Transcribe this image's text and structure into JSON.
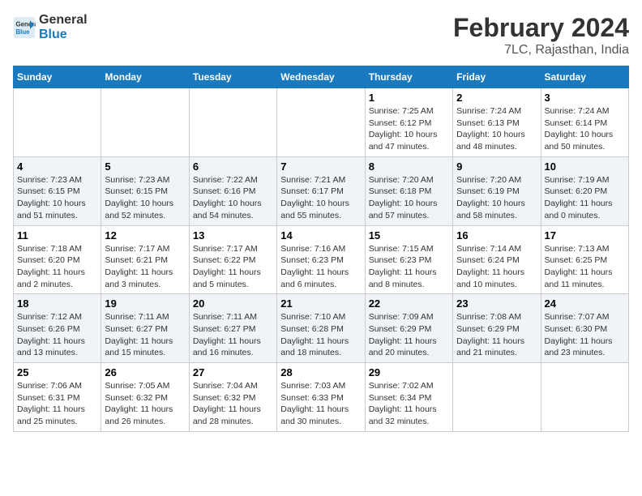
{
  "header": {
    "logo_line1": "General",
    "logo_line2": "Blue",
    "title": "February 2024",
    "subtitle": "7LC, Rajasthan, India"
  },
  "weekdays": [
    "Sunday",
    "Monday",
    "Tuesday",
    "Wednesday",
    "Thursday",
    "Friday",
    "Saturday"
  ],
  "weeks": [
    [
      {
        "day": "",
        "info": ""
      },
      {
        "day": "",
        "info": ""
      },
      {
        "day": "",
        "info": ""
      },
      {
        "day": "",
        "info": ""
      },
      {
        "day": "1",
        "info": "Sunrise: 7:25 AM\nSunset: 6:12 PM\nDaylight: 10 hours\nand 47 minutes."
      },
      {
        "day": "2",
        "info": "Sunrise: 7:24 AM\nSunset: 6:13 PM\nDaylight: 10 hours\nand 48 minutes."
      },
      {
        "day": "3",
        "info": "Sunrise: 7:24 AM\nSunset: 6:14 PM\nDaylight: 10 hours\nand 50 minutes."
      }
    ],
    [
      {
        "day": "4",
        "info": "Sunrise: 7:23 AM\nSunset: 6:15 PM\nDaylight: 10 hours\nand 51 minutes."
      },
      {
        "day": "5",
        "info": "Sunrise: 7:23 AM\nSunset: 6:15 PM\nDaylight: 10 hours\nand 52 minutes."
      },
      {
        "day": "6",
        "info": "Sunrise: 7:22 AM\nSunset: 6:16 PM\nDaylight: 10 hours\nand 54 minutes."
      },
      {
        "day": "7",
        "info": "Sunrise: 7:21 AM\nSunset: 6:17 PM\nDaylight: 10 hours\nand 55 minutes."
      },
      {
        "day": "8",
        "info": "Sunrise: 7:20 AM\nSunset: 6:18 PM\nDaylight: 10 hours\nand 57 minutes."
      },
      {
        "day": "9",
        "info": "Sunrise: 7:20 AM\nSunset: 6:19 PM\nDaylight: 10 hours\nand 58 minutes."
      },
      {
        "day": "10",
        "info": "Sunrise: 7:19 AM\nSunset: 6:20 PM\nDaylight: 11 hours\nand 0 minutes."
      }
    ],
    [
      {
        "day": "11",
        "info": "Sunrise: 7:18 AM\nSunset: 6:20 PM\nDaylight: 11 hours\nand 2 minutes."
      },
      {
        "day": "12",
        "info": "Sunrise: 7:17 AM\nSunset: 6:21 PM\nDaylight: 11 hours\nand 3 minutes."
      },
      {
        "day": "13",
        "info": "Sunrise: 7:17 AM\nSunset: 6:22 PM\nDaylight: 11 hours\nand 5 minutes."
      },
      {
        "day": "14",
        "info": "Sunrise: 7:16 AM\nSunset: 6:23 PM\nDaylight: 11 hours\nand 6 minutes."
      },
      {
        "day": "15",
        "info": "Sunrise: 7:15 AM\nSunset: 6:23 PM\nDaylight: 11 hours\nand 8 minutes."
      },
      {
        "day": "16",
        "info": "Sunrise: 7:14 AM\nSunset: 6:24 PM\nDaylight: 11 hours\nand 10 minutes."
      },
      {
        "day": "17",
        "info": "Sunrise: 7:13 AM\nSunset: 6:25 PM\nDaylight: 11 hours\nand 11 minutes."
      }
    ],
    [
      {
        "day": "18",
        "info": "Sunrise: 7:12 AM\nSunset: 6:26 PM\nDaylight: 11 hours\nand 13 minutes."
      },
      {
        "day": "19",
        "info": "Sunrise: 7:11 AM\nSunset: 6:27 PM\nDaylight: 11 hours\nand 15 minutes."
      },
      {
        "day": "20",
        "info": "Sunrise: 7:11 AM\nSunset: 6:27 PM\nDaylight: 11 hours\nand 16 minutes."
      },
      {
        "day": "21",
        "info": "Sunrise: 7:10 AM\nSunset: 6:28 PM\nDaylight: 11 hours\nand 18 minutes."
      },
      {
        "day": "22",
        "info": "Sunrise: 7:09 AM\nSunset: 6:29 PM\nDaylight: 11 hours\nand 20 minutes."
      },
      {
        "day": "23",
        "info": "Sunrise: 7:08 AM\nSunset: 6:29 PM\nDaylight: 11 hours\nand 21 minutes."
      },
      {
        "day": "24",
        "info": "Sunrise: 7:07 AM\nSunset: 6:30 PM\nDaylight: 11 hours\nand 23 minutes."
      }
    ],
    [
      {
        "day": "25",
        "info": "Sunrise: 7:06 AM\nSunset: 6:31 PM\nDaylight: 11 hours\nand 25 minutes."
      },
      {
        "day": "26",
        "info": "Sunrise: 7:05 AM\nSunset: 6:32 PM\nDaylight: 11 hours\nand 26 minutes."
      },
      {
        "day": "27",
        "info": "Sunrise: 7:04 AM\nSunset: 6:32 PM\nDaylight: 11 hours\nand 28 minutes."
      },
      {
        "day": "28",
        "info": "Sunrise: 7:03 AM\nSunset: 6:33 PM\nDaylight: 11 hours\nand 30 minutes."
      },
      {
        "day": "29",
        "info": "Sunrise: 7:02 AM\nSunset: 6:34 PM\nDaylight: 11 hours\nand 32 minutes."
      },
      {
        "day": "",
        "info": ""
      },
      {
        "day": "",
        "info": ""
      }
    ]
  ]
}
